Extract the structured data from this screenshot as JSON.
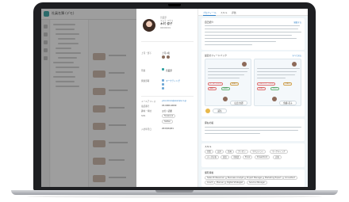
{
  "app": {
    "title": "社員名簿 (デモ)",
    "sidebar_icons": [
      "home-icon",
      "people-icon",
      "chart-icon",
      "folder-icon",
      "settings-icon"
    ]
  },
  "profile": {
    "department": "営業部",
    "kana": "キムラ ユウコ",
    "name": "木村 優子",
    "employee_no": "00000001",
    "fields": [
      {
        "label": "上司・部下",
        "value": "上司 2名"
      },
      {
        "label": "所属",
        "value": "営業部"
      },
      {
        "label": "関連部署",
        "value": "マーケティング"
      },
      {
        "label": "メールアドレス",
        "value": "yuko.kimura@example.co.jp"
      },
      {
        "label": "電話番号",
        "value": "03-0000-0000"
      },
      {
        "label": "趣味・特技",
        "value": "ヨガ / 読書"
      },
      {
        "label": "SNS",
        "value": "Facebook"
      },
      {
        "label": "入社年月日",
        "value": "2015/04/01"
      }
    ],
    "buttons": [
      "Facebook",
      "Twitter"
    ]
  },
  "detail": {
    "tabs": [
      "プロフィール",
      "スキル",
      "評価"
    ],
    "notice_title": "自己紹介",
    "notice_action": "編集する",
    "feedback_title": "最近のフィードバック",
    "feedback_action": "すべて見る",
    "chips_left": [
      "リーダーシップ",
      "提案力",
      "傾聴力",
      "協調性"
    ],
    "chips_right": [
      "コミュニケーション",
      "行動力",
      "企画力",
      "分析力"
    ],
    "user_left": "山田 太郎",
    "user_right": "佐藤 花子",
    "reply_label": "返信",
    "motto_title": "座右の銘",
    "skills_title": "スキル",
    "skills": [
      "営業",
      "交渉",
      "企画",
      "プレゼン",
      "マネジメント",
      "マーケティング",
      "データ分析",
      "英語",
      "中国語",
      "Excel",
      "PowerPoint",
      "広報"
    ],
    "qualifications_title": "保有資格",
    "qualifications": [
      "Sales Professional",
      "Business Analyst",
      "Project Manager",
      "Marketing Expert",
      "Consultant",
      "Coach",
      "Planner",
      "Digital Strategist",
      "Service Manager"
    ]
  }
}
